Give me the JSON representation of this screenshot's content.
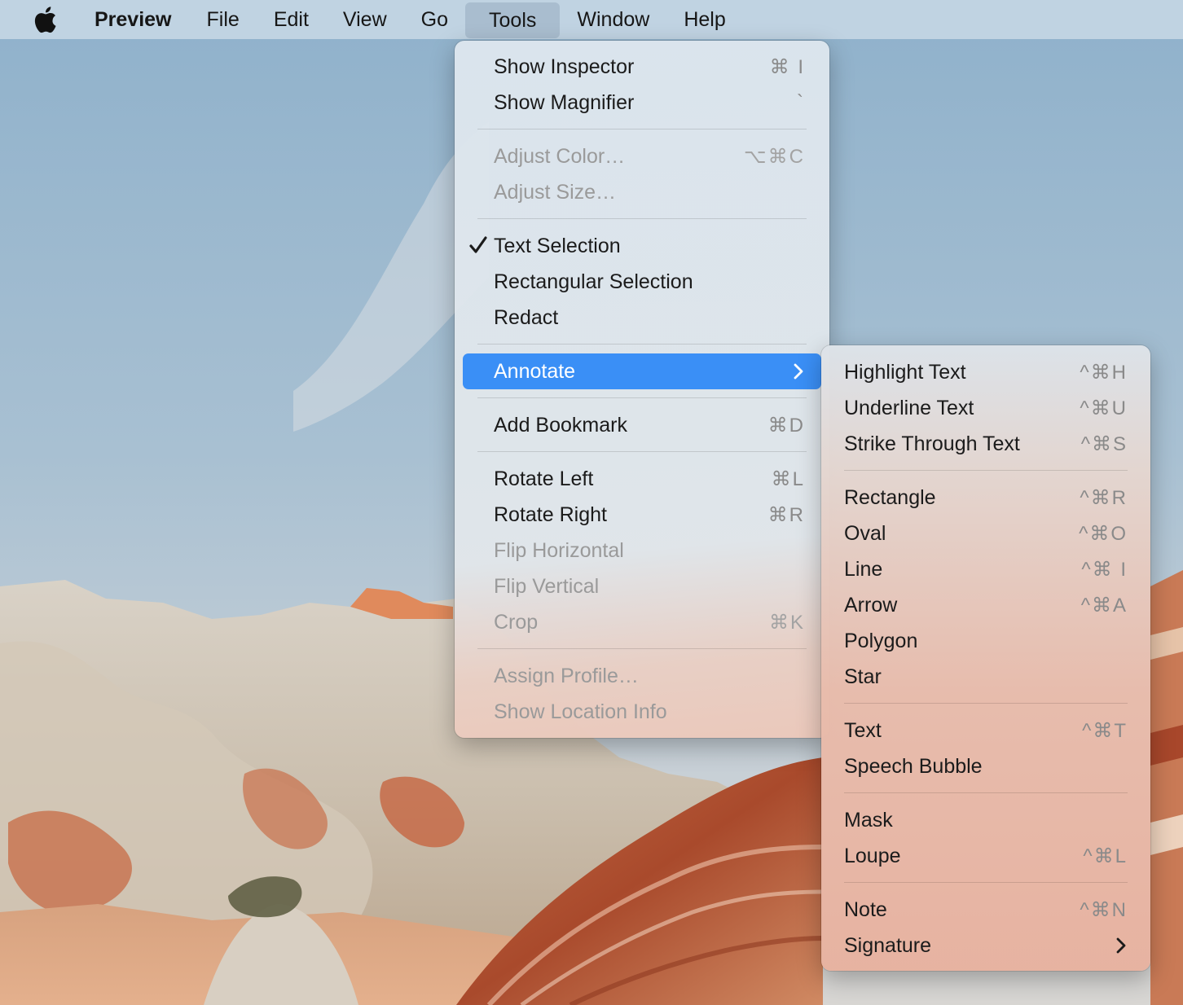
{
  "menubar": {
    "apple_icon": "apple-logo-icon",
    "app_name": "Preview",
    "items": [
      "File",
      "Edit",
      "View",
      "Go",
      "Tools",
      "Window",
      "Help"
    ],
    "active_item": "Tools"
  },
  "tools_menu": {
    "show_inspector": {
      "label": "Show Inspector",
      "shortcut": "⌘ I"
    },
    "show_magnifier": {
      "label": "Show Magnifier",
      "shortcut": "`"
    },
    "adjust_color": {
      "label": "Adjust Color…",
      "shortcut": "⌥⌘C"
    },
    "adjust_size": {
      "label": "Adjust Size…"
    },
    "text_selection": {
      "label": "Text Selection",
      "checked": true
    },
    "rectangular_selection": {
      "label": "Rectangular Selection"
    },
    "redact": {
      "label": "Redact"
    },
    "annotate": {
      "label": "Annotate"
    },
    "add_bookmark": {
      "label": "Add Bookmark",
      "shortcut": "⌘D"
    },
    "rotate_left": {
      "label": "Rotate Left",
      "shortcut": "⌘L"
    },
    "rotate_right": {
      "label": "Rotate Right",
      "shortcut": "⌘R"
    },
    "flip_horizontal": {
      "label": "Flip Horizontal"
    },
    "flip_vertical": {
      "label": "Flip Vertical"
    },
    "crop": {
      "label": "Crop",
      "shortcut": "⌘K"
    },
    "assign_profile": {
      "label": "Assign Profile…"
    },
    "show_location_info": {
      "label": "Show Location Info"
    }
  },
  "annotate_menu": {
    "highlight_text": {
      "label": "Highlight Text",
      "shortcut": "^⌘H"
    },
    "underline_text": {
      "label": "Underline Text",
      "shortcut": "^⌘U"
    },
    "strike_through_text": {
      "label": "Strike Through Text",
      "shortcut": "^⌘S"
    },
    "rectangle": {
      "label": "Rectangle",
      "shortcut": "^⌘R"
    },
    "oval": {
      "label": "Oval",
      "shortcut": "^⌘O"
    },
    "line": {
      "label": "Line",
      "shortcut": "^⌘ I"
    },
    "arrow": {
      "label": "Arrow",
      "shortcut": "^⌘A"
    },
    "polygon": {
      "label": "Polygon"
    },
    "star": {
      "label": "Star"
    },
    "text": {
      "label": "Text",
      "shortcut": "^⌘T"
    },
    "speech_bubble": {
      "label": "Speech Bubble"
    },
    "mask": {
      "label": "Mask"
    },
    "loupe": {
      "label": "Loupe",
      "shortcut": "^⌘L"
    },
    "note": {
      "label": "Note",
      "shortcut": "^⌘N"
    },
    "signature": {
      "label": "Signature"
    }
  },
  "colors": {
    "highlight": "#3a8ff6",
    "disabled_text": "#9a9a9a",
    "shortcut_text": "#8a8a8a"
  }
}
